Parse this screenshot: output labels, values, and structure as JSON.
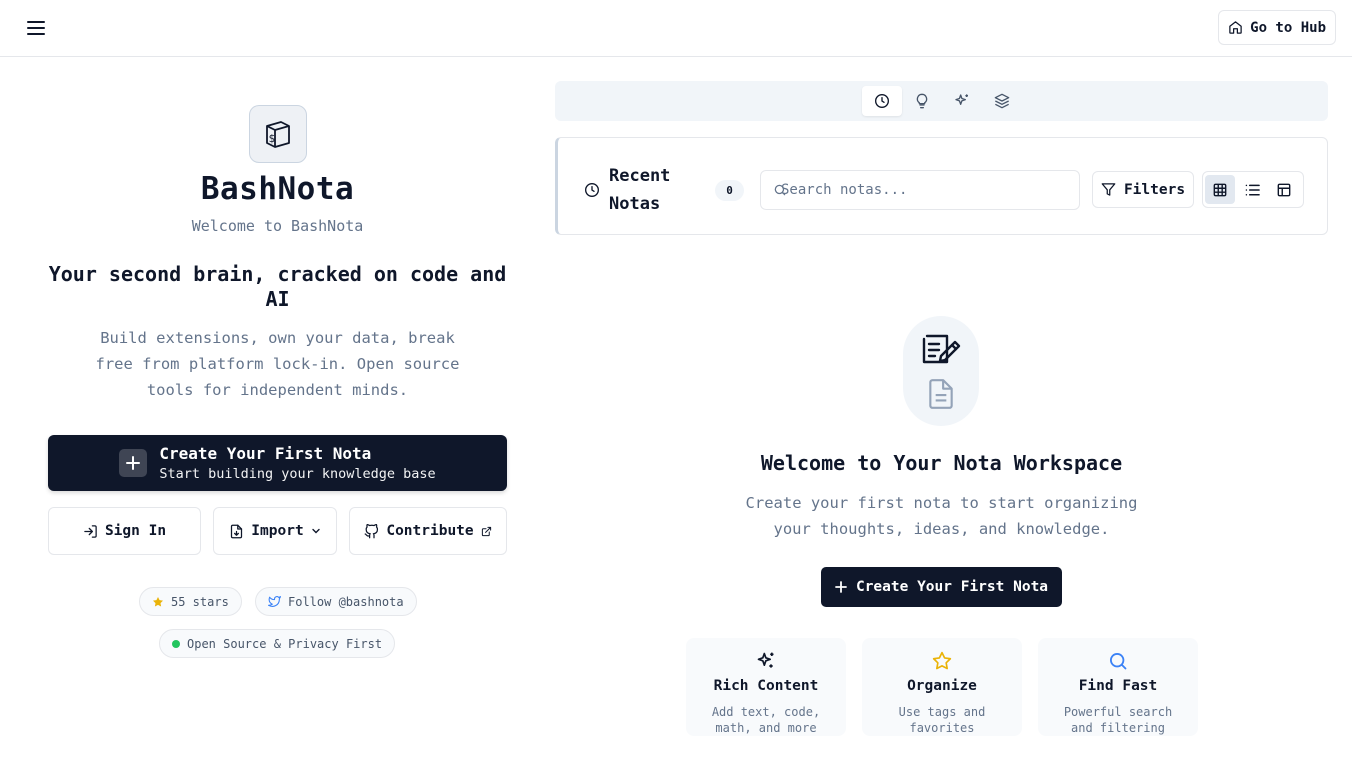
{
  "header": {
    "menu_icon": "hamburger-menu-icon",
    "hub_label": "Go to Hub",
    "hub_icon": "home-icon"
  },
  "intro": {
    "logo_icon": "terminal-package-icon",
    "app_name": "BashNota",
    "welcome": "Welcome to BashNota",
    "headline": "Your second brain, cracked on code and AI",
    "description": "Build extensions, own your data, break free from platform lock-in. Open source tools for independent minds.",
    "cta_title": "Create Your First Nota",
    "cta_subtitle": "Start building your knowledge base",
    "sign_in": "Sign In",
    "import": "Import",
    "contribute": "Contribute",
    "stars": "55 stars",
    "follow": "Follow @bashnota",
    "open_source": "Open Source & Privacy First",
    "accent_star_color": "#eab308",
    "status_color": "#22c55e"
  },
  "tabs": [
    {
      "icon": "clock-icon",
      "active": true
    },
    {
      "icon": "lightbulb-icon",
      "active": false
    },
    {
      "icon": "sparkles-icon",
      "active": false
    },
    {
      "icon": "layers-icon",
      "active": false
    }
  ],
  "notas_panel": {
    "title": "Recent Notas",
    "count": "0",
    "search_placeholder": "Search notas...",
    "filters_label": "Filters",
    "view_modes": [
      "grid-view-icon",
      "list-view-icon",
      "table-view-icon"
    ],
    "active_view": "grid"
  },
  "empty_state": {
    "title": "Welcome to Your Nota Workspace",
    "description": "Create your first nota to start organizing your thoughts, ideas, and knowledge.",
    "cta": "Create Your First Nota",
    "features": [
      {
        "icon": "sparkles-icon",
        "title": "Rich Content",
        "desc": "Add text, code, math, and more",
        "color": "#0f172a"
      },
      {
        "icon": "star-icon",
        "title": "Organize",
        "desc": "Use tags and favorites",
        "color": "#eab308"
      },
      {
        "icon": "search-icon",
        "title": "Find Fast",
        "desc": "Powerful search and filtering",
        "color": "#3b82f6"
      }
    ]
  }
}
